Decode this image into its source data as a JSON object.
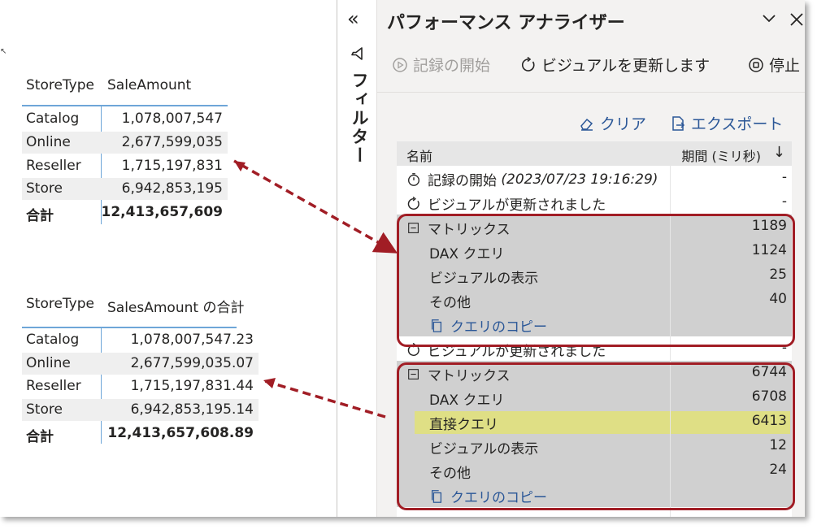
{
  "table1": {
    "headers": [
      "StoreType",
      "SaleAmount"
    ],
    "rows": [
      {
        "type": "Catalog",
        "amount": "1,078,007,547"
      },
      {
        "type": "Online",
        "amount": "2,677,599,035"
      },
      {
        "type": "Reseller",
        "amount": "1,715,197,831"
      },
      {
        "type": "Store",
        "amount": "6,942,853,195"
      }
    ],
    "total": {
      "label": "合計",
      "amount": "12,413,657,609"
    }
  },
  "table2": {
    "headers": [
      "StoreType",
      "SalesAmount の合計"
    ],
    "rows": [
      {
        "type": "Catalog",
        "amount": "1,078,007,547.23"
      },
      {
        "type": "Online",
        "amount": "2,677,599,035.07"
      },
      {
        "type": "Reseller",
        "amount": "1,715,197,831.44"
      },
      {
        "type": "Store",
        "amount": "6,942,853,195.14"
      }
    ],
    "total": {
      "label": "合計",
      "amount": "12,413,657,608.89"
    }
  },
  "filter_rail": {
    "collapse_glyph": "«",
    "label": "フィルター"
  },
  "panel": {
    "title": "パフォーマンス アナライザー",
    "toolbar": {
      "start": "記録の開始",
      "refresh": "ビジュアルを更新します",
      "stop": "停止"
    },
    "actions": {
      "clear": "クリア",
      "export": "エクスポート"
    },
    "columns": {
      "name": "名前",
      "duration": "期間 (ミリ秒)",
      "sort_glyph": "↓"
    },
    "rows": [
      {
        "label": "記録の開始",
        "detail": "(2023/07/23 19:16:29)",
        "value": "-"
      },
      {
        "label": "ビジュアルが更新されました",
        "value": "-"
      },
      {
        "label": "マトリックス",
        "value": "1189"
      },
      {
        "label": "DAX クエリ",
        "value": "1124"
      },
      {
        "label": "ビジュアルの表示",
        "value": "25"
      },
      {
        "label": "その他",
        "value": "40"
      },
      {
        "label": "クエリのコピー"
      },
      {
        "label": "ビジュアルが更新されました",
        "value": "-"
      },
      {
        "label": "マトリックス",
        "value": "6744"
      },
      {
        "label": "DAX クエリ",
        "value": "6708"
      },
      {
        "label": "直接クエリ",
        "value": "6413"
      },
      {
        "label": "ビジュアルの表示",
        "value": "12"
      },
      {
        "label": "その他",
        "value": "24"
      },
      {
        "label": "クエリのコピー"
      }
    ]
  },
  "colors": {
    "accent": "#2b5797",
    "callout": "#a11d25",
    "highlight": "#dfdf85",
    "rule": "#6ea6d8"
  }
}
